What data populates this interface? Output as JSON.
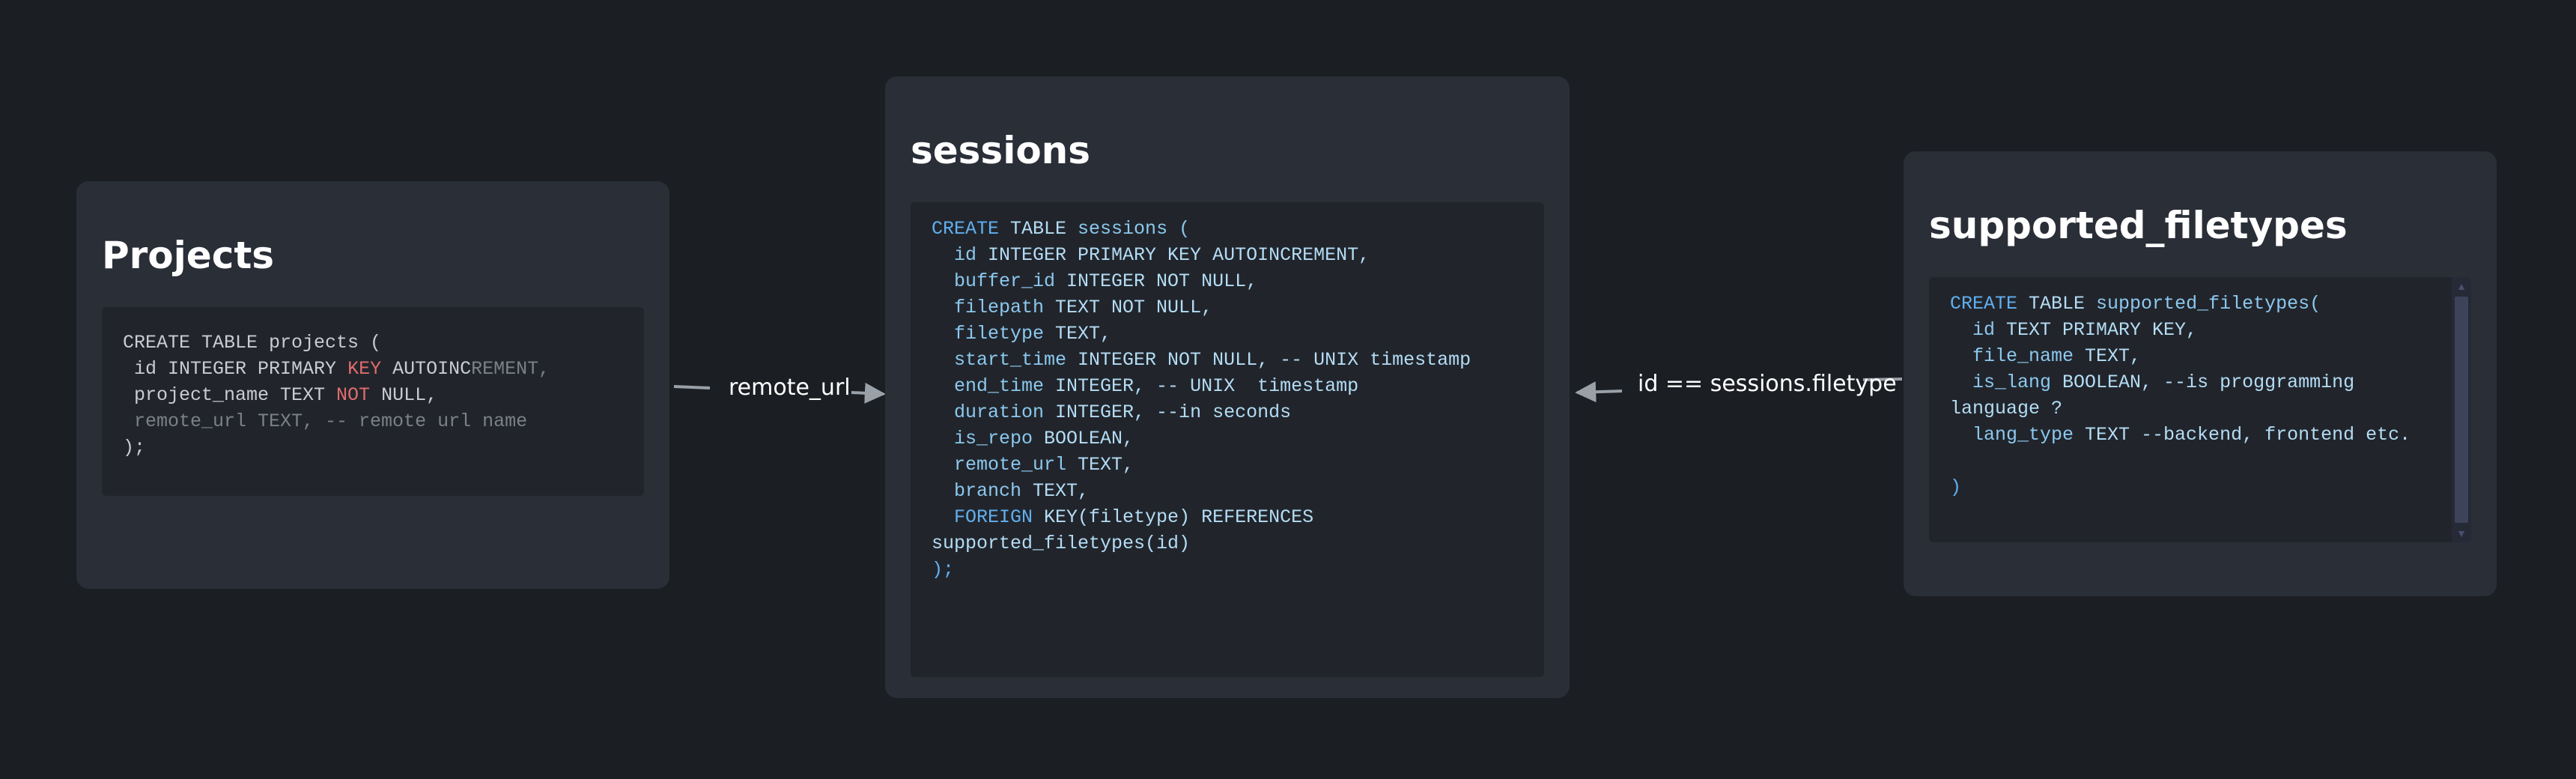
{
  "nodes": [
    {
      "id": "projects",
      "title": "Projects",
      "code": [
        [
          [
            "tk-plain",
            "CREATE TABLE projects ("
          ]
        ],
        [
          [
            "tk-plain",
            " id INTEGER PRIMARY "
          ],
          [
            "tk-red",
            "KEY"
          ],
          [
            "tk-plain",
            " AUTOINC"
          ],
          [
            "tk-dim",
            "REMENT,"
          ]
        ],
        [
          [
            "tk-plain",
            " project_name TEXT "
          ],
          [
            "tk-red",
            "NOT"
          ],
          [
            "tk-plain",
            " NULL,"
          ]
        ],
        [
          [
            "tk-dim",
            " remote_url TEXT, -- remote url name"
          ]
        ],
        [
          [
            "tk-plain",
            ");"
          ]
        ]
      ]
    },
    {
      "id": "sessions",
      "title": "sessions",
      "code": [
        [
          [
            "tk-kw",
            "CREATE"
          ],
          [
            "tk-type",
            " TABLE "
          ],
          [
            "tk-ident",
            "sessions ("
          ]
        ],
        [
          [
            "tk-ident",
            "  id"
          ],
          [
            "tk-type",
            " INTEGER PRIMARY KEY AUTOINCREMENT,"
          ]
        ],
        [
          [
            "tk-ident",
            "  buffer_id"
          ],
          [
            "tk-type",
            " INTEGER NOT NULL,"
          ]
        ],
        [
          [
            "tk-ident",
            "  filepath"
          ],
          [
            "tk-type",
            " TEXT NOT NULL,"
          ]
        ],
        [
          [
            "tk-ident",
            "  filetype"
          ],
          [
            "tk-type",
            " TEXT,"
          ]
        ],
        [
          [
            "tk-ident",
            "  start_time"
          ],
          [
            "tk-type",
            " INTEGER NOT NULL, -- UNIX timestamp"
          ]
        ],
        [
          [
            "tk-ident",
            "  end_time"
          ],
          [
            "tk-type",
            " INTEGER, -- UNIX  timestamp"
          ]
        ],
        [
          [
            "tk-ident",
            "  duration"
          ],
          [
            "tk-type",
            " INTEGER, --in seconds"
          ]
        ],
        [
          [
            "tk-ident",
            "  is_repo"
          ],
          [
            "tk-type",
            " BOOLEAN,"
          ]
        ],
        [
          [
            "tk-ident",
            "  remote_url"
          ],
          [
            "tk-type",
            " TEXT,"
          ]
        ],
        [
          [
            "tk-ident",
            "  branch"
          ],
          [
            "tk-type",
            " TEXT,"
          ]
        ],
        [
          [
            "tk-kw",
            "  FOREIGN"
          ],
          [
            "tk-type",
            " KEY(filetype) REFERENCES"
          ]
        ],
        [
          [
            "tk-type",
            "supported_filetypes(id)"
          ]
        ],
        [
          [
            "tk-kw",
            ");"
          ]
        ]
      ]
    },
    {
      "id": "supported_filetypes",
      "title": "supported_filetypes",
      "code": [
        [
          [
            "tk-kw",
            "CREATE"
          ],
          [
            "tk-type",
            " TABLE "
          ],
          [
            "tk-ident",
            "supported_filetypes("
          ]
        ],
        [
          [
            "tk-ident",
            "  id"
          ],
          [
            "tk-type",
            " TEXT PRIMARY KEY,"
          ]
        ],
        [
          [
            "tk-ident",
            "  file_name"
          ],
          [
            "tk-type",
            " TEXT,"
          ]
        ],
        [
          [
            "tk-ident",
            "  is_lang"
          ],
          [
            "tk-type",
            " BOOLEAN, --is proggramming"
          ]
        ],
        [
          [
            "tk-type",
            "language ?"
          ]
        ],
        [
          [
            "tk-ident",
            "  lang_type"
          ],
          [
            "tk-type",
            " TEXT --backend, frontend etc."
          ]
        ],
        [
          [
            "tk-plain",
            ""
          ]
        ],
        [
          [
            "tk-kw",
            ")"
          ]
        ]
      ]
    }
  ],
  "edges": {
    "projects_to_sessions": "remote_url",
    "filetypes_to_sessions": "id == sessions.filetype"
  },
  "colors": {
    "background": "#1b1e23",
    "card": "#292e37",
    "code_bg": "#21252b",
    "edge": "#9aa0a8"
  }
}
